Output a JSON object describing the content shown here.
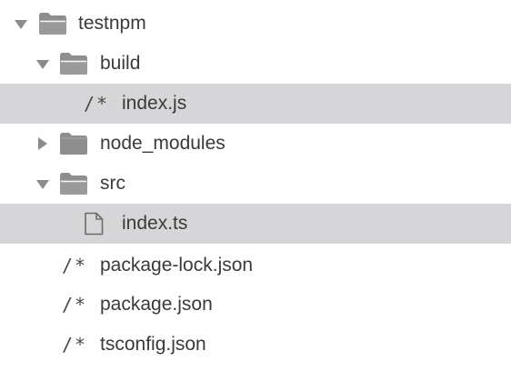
{
  "tree": {
    "root": {
      "label": "testnpm",
      "expanded": true,
      "icon": "folder-open-icon"
    },
    "build": {
      "label": "build",
      "expanded": true,
      "icon": "folder-open-icon"
    },
    "build_index": {
      "label": "index.js",
      "icon": "js-file-icon",
      "glyph": "/*",
      "selected": true
    },
    "node_modules": {
      "label": "node_modules",
      "expanded": false,
      "icon": "folder-closed-icon"
    },
    "src": {
      "label": "src",
      "expanded": true,
      "icon": "folder-open-icon"
    },
    "src_index": {
      "label": "index.ts",
      "icon": "document-icon",
      "selected": true
    },
    "package_lock": {
      "label": "package-lock.json",
      "icon": "js-file-icon",
      "glyph": "/*"
    },
    "package": {
      "label": "package.json",
      "icon": "js-file-icon",
      "glyph": "/*"
    },
    "tsconfig": {
      "label": "tsconfig.json",
      "icon": "js-file-icon",
      "glyph": "/*"
    }
  },
  "colors": {
    "selection": "#d6d6d8",
    "arrow": "#8b8b8b",
    "folder": "#8e8e8e",
    "text": "#3a3a3a"
  }
}
